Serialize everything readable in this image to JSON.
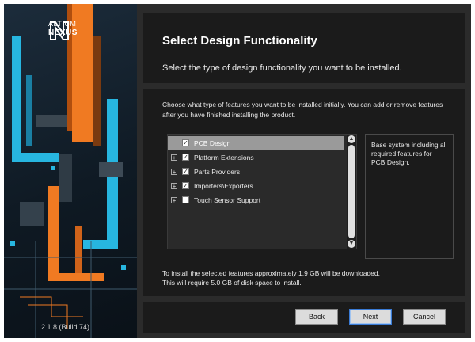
{
  "app": {
    "logo_line1": "ALTIUM",
    "logo_line2": "NEXUS",
    "version": "2.1.8 (Build 74)"
  },
  "header": {
    "title": "Select Design Functionality",
    "subtitle": "Select the type of design functionality you want to be installed."
  },
  "content": {
    "intro": "Choose what type of features you want to be installed initially. You can add or remove features after you have finished installing the product.",
    "tree": [
      {
        "label": "PCB Design",
        "checked": true,
        "expandable": false,
        "selected": true
      },
      {
        "label": "Platform Extensions",
        "checked": true,
        "expandable": true,
        "selected": false
      },
      {
        "label": "Parts Providers",
        "checked": true,
        "expandable": true,
        "selected": false
      },
      {
        "label": "Importers\\Exporters",
        "checked": true,
        "expandable": true,
        "selected": false
      },
      {
        "label": "Touch Sensor Support",
        "checked": false,
        "expandable": true,
        "selected": false
      }
    ],
    "description": "Base system including all required features for PCB Design.",
    "footer_line1": "To install the selected features approximately 1.9 GB will be downloaded.",
    "footer_line2": "This will require 5.0 GB of disk space to install."
  },
  "buttons": {
    "back": "Back",
    "next": "Next",
    "cancel": "Cancel"
  },
  "icons": {
    "check": "✓",
    "expander": "+",
    "scroll_up": "▲",
    "scroll_down": "▼"
  },
  "colors": {
    "orange": "#f07a22",
    "cyan": "#27b6e0",
    "panel": "#1b1b1b",
    "window": "#2b2b2b",
    "selection": "#9a9a9a"
  }
}
